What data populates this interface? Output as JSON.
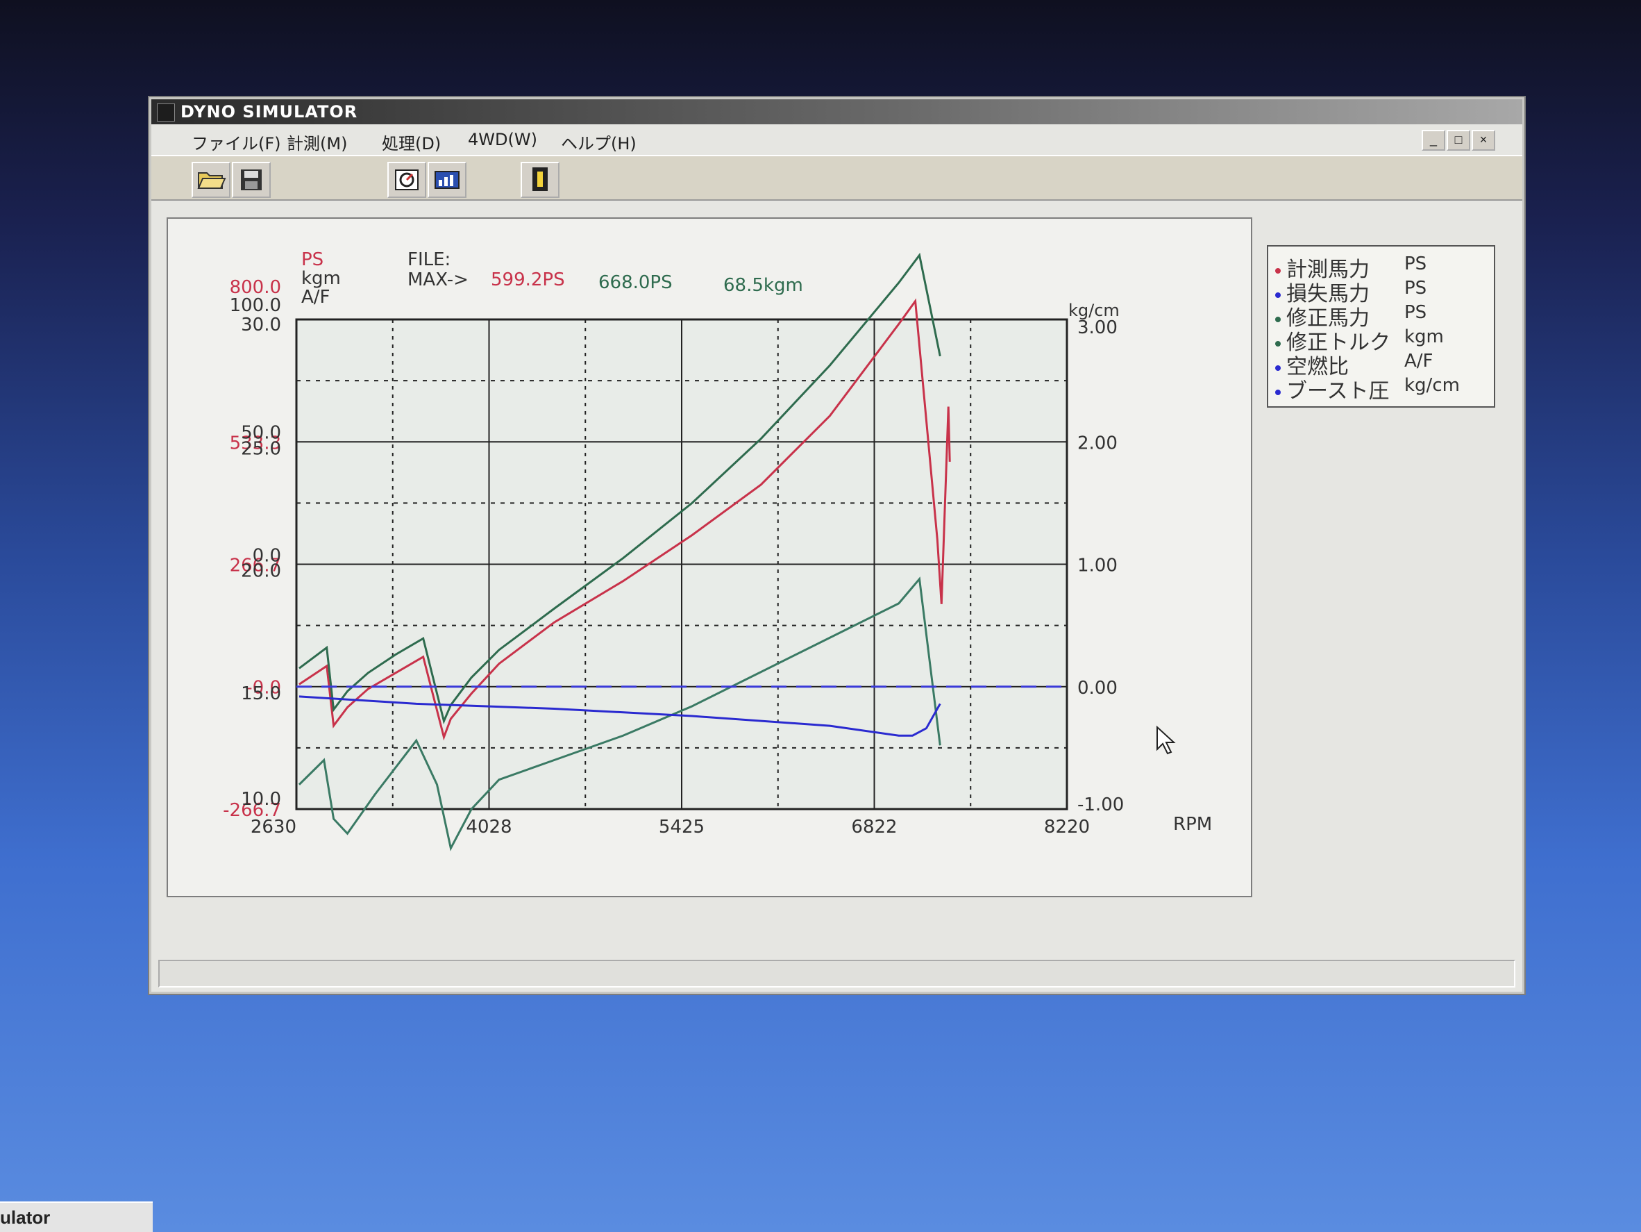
{
  "window": {
    "title": "DYNO SIMULATOR",
    "buttons": {
      "minimize": "_",
      "maximize": "□",
      "close": "×"
    }
  },
  "menu": [
    "ファイル(F)",
    "計測(M)",
    "処理(D)",
    "4WD(W)",
    "ヘルプ(H)"
  ],
  "toolbar": {
    "icons": [
      "open-folder-icon",
      "save-disk-icon",
      "measure-icon",
      "graph-icon",
      "info-icon"
    ]
  },
  "graph": {
    "left_headers": {
      "ps": "PS",
      "kgm": "kgm",
      "af": "A/F"
    },
    "file_label": "FILE:",
    "max_label": "MAX->",
    "max_ps_measured": "599.2PS",
    "max_ps_corrected": "668.0PS",
    "max_torque": "68.5kgm",
    "right_axis_unit": "kg/cm",
    "rpm_label": "RPM",
    "ps_ticks": [
      "800.0",
      "533.3",
      "266.7",
      "-0.0",
      "-266.7"
    ],
    "kgm_ticks": [
      "100.0",
      "50.0",
      "0.0"
    ],
    "af_ticks": [
      "30.0",
      "25.0",
      "20.0",
      "15.0",
      "10.0"
    ],
    "boost_ticks": [
      "3.00",
      "2.00",
      "1.00",
      "0.00",
      "-1.00"
    ],
    "rpm_ticks": [
      "2630",
      "4028",
      "5425",
      "6822",
      "8220"
    ]
  },
  "chart_data": {
    "type": "line",
    "title": "",
    "x_label": "RPM",
    "x_range": [
      2630,
      8220
    ],
    "y_axes": {
      "ps": [
        -266.7,
        800.0
      ],
      "kgm": [
        0,
        100
      ],
      "af": [
        10,
        30
      ],
      "boost_kg_cm": [
        -1.0,
        3.0
      ]
    },
    "grid": true,
    "colors": {
      "measured_ps": "#c8324a",
      "corrected_ps": "#2e6b4e",
      "torque": "#3a7a64",
      "af": "#2a2ad0",
      "boost": "#3a3ad8"
    },
    "series": [
      {
        "name": "計測馬力",
        "unit": "PS",
        "color": "#c8324a",
        "x": [
          2650,
          2850,
          2900,
          3000,
          3150,
          3350,
          3550,
          3700,
          3750,
          3900,
          4100,
          4500,
          5000,
          5500,
          6000,
          6500,
          7000,
          7120,
          7280,
          7310,
          7360,
          7370
        ],
        "y": [
          5,
          45,
          -85,
          -45,
          -5,
          30,
          65,
          -110,
          -70,
          -15,
          50,
          140,
          230,
          330,
          440,
          590,
          790,
          840,
          320,
          180,
          610,
          490
        ]
      },
      {
        "name": "修正馬力",
        "unit": "PS",
        "color": "#2e6b4e",
        "x": [
          2650,
          2850,
          2900,
          3000,
          3150,
          3350,
          3550,
          3700,
          3750,
          3900,
          4100,
          4500,
          5000,
          5500,
          6000,
          6500,
          7000,
          7150,
          7300
        ],
        "y": [
          40,
          85,
          -50,
          -10,
          30,
          70,
          105,
          -75,
          -40,
          20,
          80,
          170,
          280,
          400,
          540,
          700,
          880,
          940,
          720
        ]
      },
      {
        "name": "修正トルク",
        "unit": "kgm",
        "color": "#3a7a64",
        "x": [
          2650,
          2830,
          2900,
          3000,
          3200,
          3500,
          3650,
          3750,
          3900,
          4100,
          4500,
          5000,
          5500,
          6000,
          6500,
          7000,
          7150,
          7300
        ],
        "y": [
          5,
          10,
          -2,
          -5,
          3,
          14,
          5,
          -8,
          0,
          6,
          10,
          15,
          21,
          28,
          35,
          42,
          47,
          13
        ]
      },
      {
        "name": "空燃比",
        "unit": "A/F",
        "color": "#2a2ad0",
        "x": [
          2650,
          3500,
          4500,
          5500,
          6500,
          7000,
          7100,
          7200,
          7300
        ],
        "y": [
          14.6,
          14.3,
          14.1,
          13.8,
          13.4,
          13.0,
          13.0,
          13.3,
          14.3
        ]
      },
      {
        "name": "ブースト圧",
        "unit": "kg/cm",
        "color": "#3a3ad8",
        "x": [
          2630,
          8220
        ],
        "y": [
          0.0,
          0.0
        ]
      }
    ]
  },
  "legend": [
    {
      "name": "計測馬力",
      "unit": "PS",
      "color": "#c8324a"
    },
    {
      "name": "損失馬力",
      "unit": "PS",
      "color": "#2a2ad0"
    },
    {
      "name": "修正馬力",
      "unit": "PS",
      "color": "#2e6b4e"
    },
    {
      "name": "修正トルク",
      "unit": "kgm",
      "color": "#2e6b4e"
    },
    {
      "name": "空燃比",
      "unit": "A/F",
      "color": "#2a2ad0"
    },
    {
      "name": "ブースト圧",
      "unit": "kg/cm",
      "color": "#2a2ad0"
    }
  ],
  "taskbar": {
    "label": "ulator"
  }
}
